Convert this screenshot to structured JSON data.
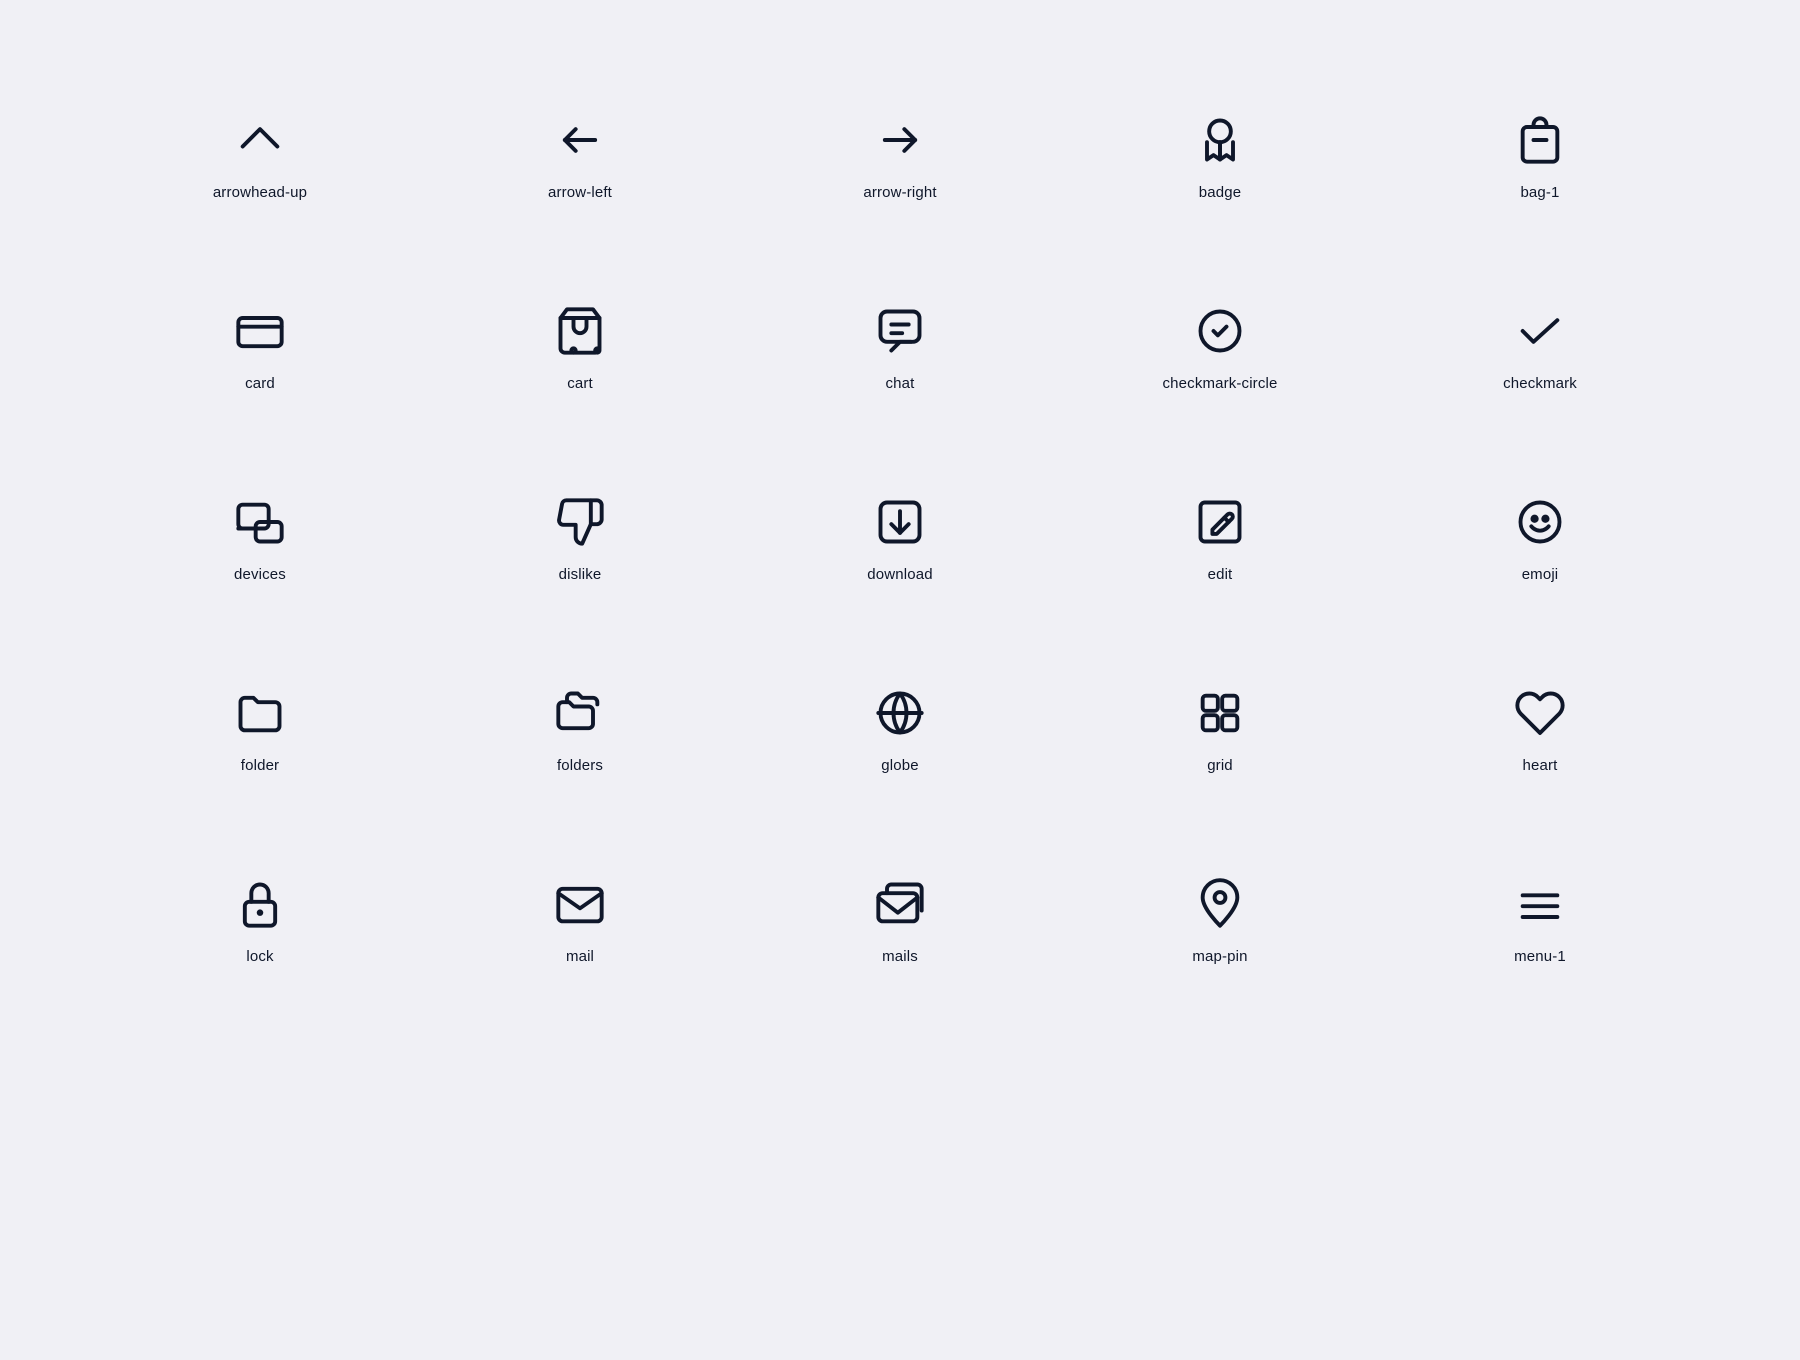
{
  "icons": [
    {
      "name": "arrowhead-up",
      "label": "arrowhead-up"
    },
    {
      "name": "arrow-left",
      "label": "arrow-left"
    },
    {
      "name": "arrow-right",
      "label": "arrow-right"
    },
    {
      "name": "badge",
      "label": "badge"
    },
    {
      "name": "bag-1",
      "label": "bag-1"
    },
    {
      "name": "card",
      "label": "card"
    },
    {
      "name": "cart",
      "label": "cart"
    },
    {
      "name": "chat",
      "label": "chat"
    },
    {
      "name": "checkmark-circle",
      "label": "checkmark-circle"
    },
    {
      "name": "checkmark",
      "label": "checkmark"
    },
    {
      "name": "devices",
      "label": "devices"
    },
    {
      "name": "dislike",
      "label": "dislike"
    },
    {
      "name": "download",
      "label": "download"
    },
    {
      "name": "edit",
      "label": "edit"
    },
    {
      "name": "emoji",
      "label": "emoji"
    },
    {
      "name": "folder",
      "label": "folder"
    },
    {
      "name": "folders",
      "label": "folders"
    },
    {
      "name": "globe",
      "label": "globe"
    },
    {
      "name": "grid",
      "label": "grid"
    },
    {
      "name": "heart",
      "label": "heart"
    },
    {
      "name": "lock",
      "label": "lock"
    },
    {
      "name": "mail",
      "label": "mail"
    },
    {
      "name": "mails",
      "label": "mails"
    },
    {
      "name": "map-pin",
      "label": "map-pin"
    },
    {
      "name": "menu-1",
      "label": "menu-1"
    }
  ]
}
